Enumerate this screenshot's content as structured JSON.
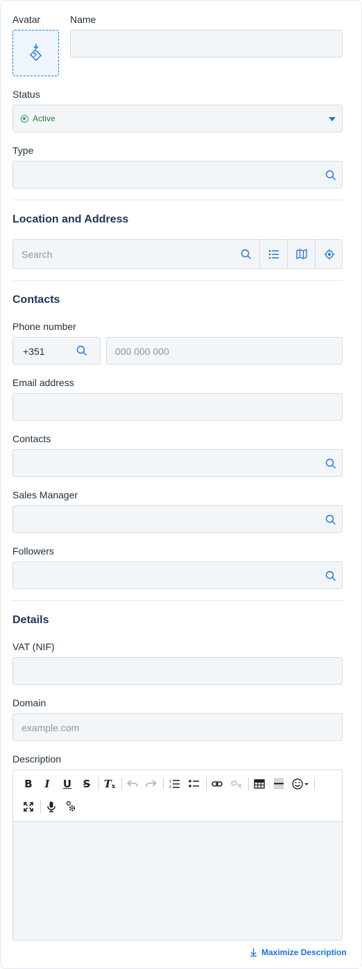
{
  "avatar": {
    "label": "Avatar"
  },
  "name": {
    "label": "Name",
    "value": ""
  },
  "status": {
    "label": "Status",
    "value": "Active"
  },
  "type": {
    "label": "Type",
    "value": ""
  },
  "location": {
    "title": "Location and Address",
    "search_placeholder": "Search"
  },
  "contacts_section": {
    "title": "Contacts"
  },
  "phone": {
    "label": "Phone number",
    "country_code": "+351",
    "placeholder": "000 000 000"
  },
  "email": {
    "label": "Email address",
    "value": ""
  },
  "contacts": {
    "label": "Contacts",
    "value": ""
  },
  "sales_manager": {
    "label": "Sales Manager",
    "value": ""
  },
  "followers": {
    "label": "Followers",
    "value": ""
  },
  "details": {
    "title": "Details"
  },
  "vat": {
    "label": "VAT (NIF)",
    "value": ""
  },
  "domain": {
    "label": "Domain",
    "placeholder": "example.com"
  },
  "description": {
    "label": "Description",
    "maximize_label": "Maximize Description"
  },
  "colors": {
    "accent": "#1a73e8",
    "active": "#2e9e5b",
    "field_bg": "#f3f6f9",
    "border": "#d4dbe3"
  }
}
